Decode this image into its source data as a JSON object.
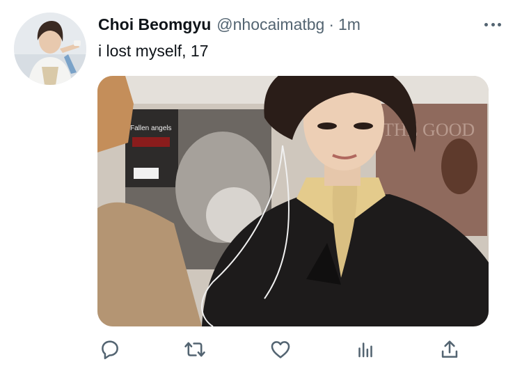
{
  "tweet": {
    "author_name": "Choi Beomgyu",
    "handle": "@nhocaimatbg",
    "separator": "·",
    "time": "1m",
    "text": "i lost myself, 17"
  },
  "media": {
    "album_text": "Fallen angels",
    "poster_text": "THE GOOD"
  },
  "icons": {
    "more": "more-dots-icon",
    "reply": "reply-icon",
    "retweet": "retweet-icon",
    "like": "heart-icon",
    "views": "analytics-icon",
    "share": "share-icon"
  },
  "colors": {
    "name": "#0f1419",
    "secondary": "#536471",
    "background": "#ffffff"
  }
}
